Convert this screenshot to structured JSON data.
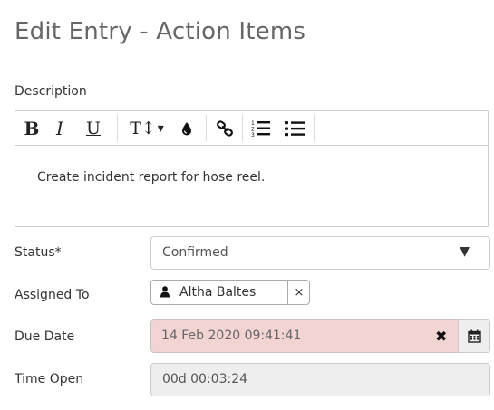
{
  "page": {
    "title": "Edit Entry - Action Items"
  },
  "description": {
    "label": "Description",
    "content": "Create incident report for hose reel.",
    "toolbar": {
      "bold": "B",
      "italic": "I",
      "underline": "U",
      "font_size": "T↕",
      "font_size_caret": "▾"
    }
  },
  "status": {
    "label": "Status*",
    "value": "Confirmed"
  },
  "assigned_to": {
    "label": "Assigned To",
    "value": "Altha Baltes",
    "remove": "×"
  },
  "due_date": {
    "label": "Due Date",
    "value": "14 Feb 2020 09:41:41",
    "clear": "✖"
  },
  "time_open": {
    "label": "Time Open",
    "value": "00d 00:03:24"
  },
  "colors": {
    "due_date_bg": "#f2d4d3",
    "readonly_bg": "#eeeeee",
    "title_text": "#666666"
  },
  "icons": [
    "tint-icon",
    "link-icon",
    "ordered-list-icon",
    "unordered-list-icon",
    "chevron-down-icon",
    "user-icon",
    "calendar-icon"
  ]
}
